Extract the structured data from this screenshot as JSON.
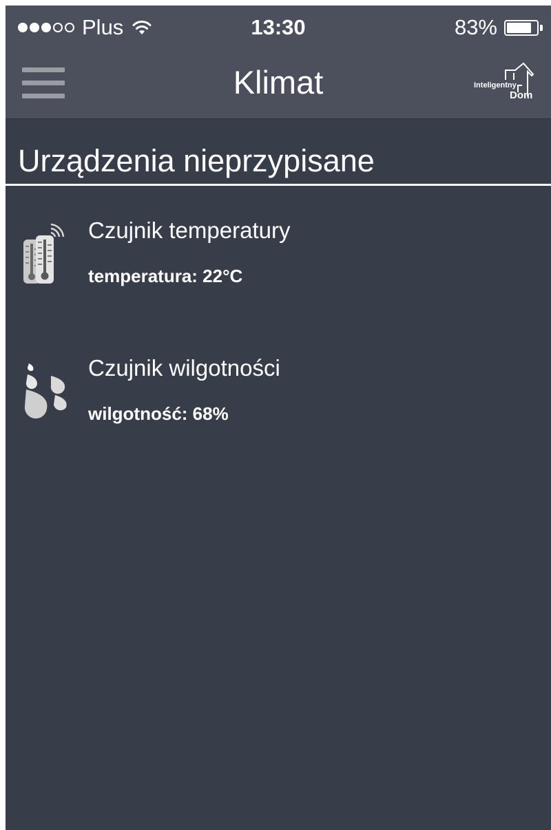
{
  "status_bar": {
    "carrier": "Plus",
    "signal_bars": 3,
    "signal_max": 5,
    "time": "13:30",
    "battery_percent_label": "83%",
    "battery_level": 0.83
  },
  "nav": {
    "title": "Klimat",
    "menu_icon": "hamburger-menu-icon",
    "logo": {
      "line1": "Inteligentny",
      "line2": "Dom"
    }
  },
  "section": {
    "title": "Urządzenia nieprzypisane"
  },
  "devices": [
    {
      "icon": "thermometer-icon",
      "name": "Czujnik temperatury",
      "value": "temperatura: 22°C"
    },
    {
      "icon": "humidity-drops-icon",
      "name": "Czujnik wilgotności",
      "value": "wilgotność: 68%"
    }
  ],
  "colors": {
    "background": "#383d4a",
    "bar": "#4b505c",
    "text": "#ffffff"
  }
}
